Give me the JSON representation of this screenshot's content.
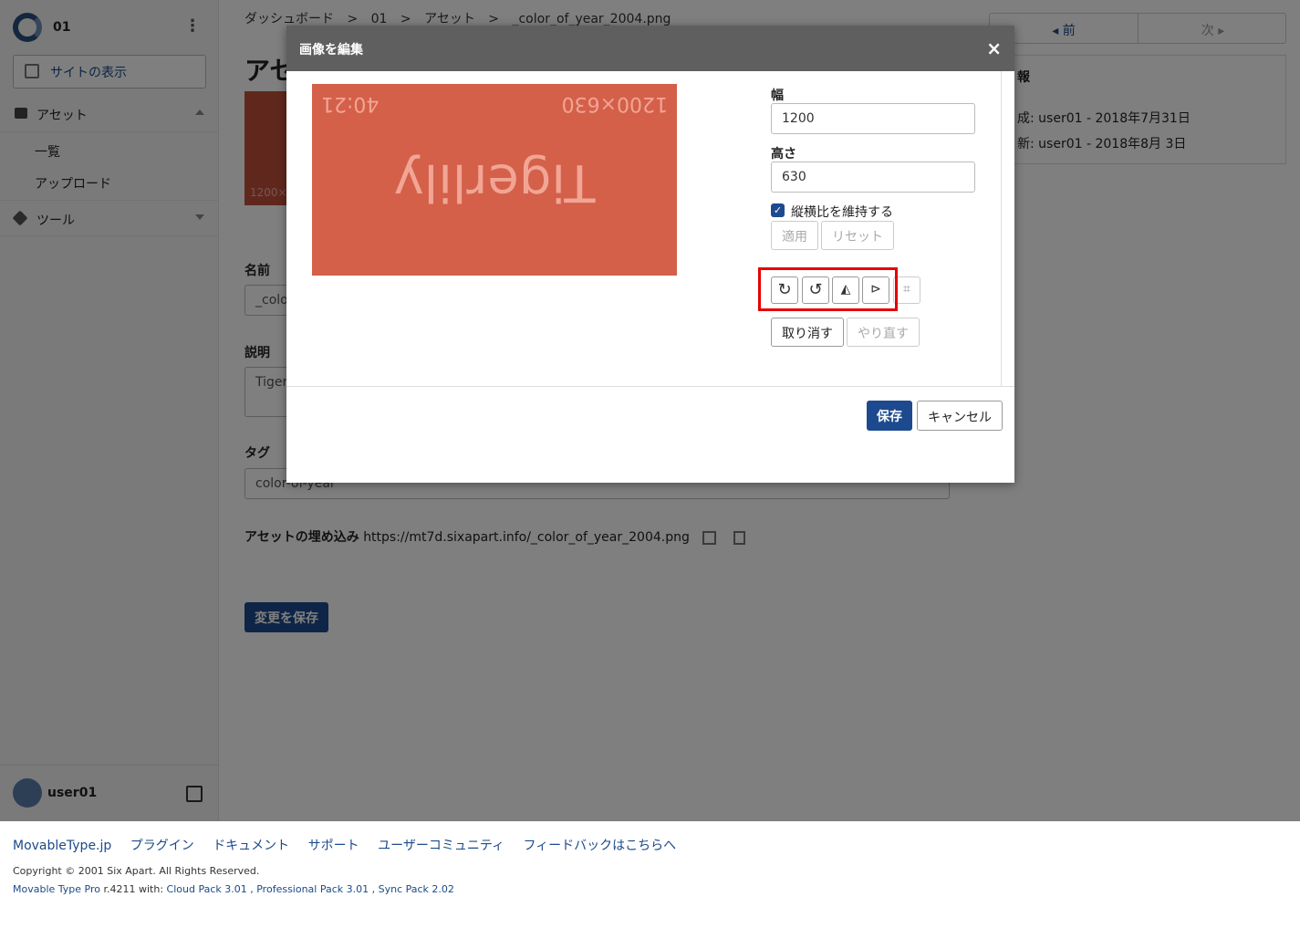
{
  "sidebar": {
    "site_name": "01",
    "view_site": "サイトの表示",
    "sections": [
      {
        "label": "アセット",
        "items": [
          "一覧",
          "アップロード"
        ]
      },
      {
        "label": "ツール"
      }
    ],
    "user": "user01"
  },
  "breadcrumb": [
    "ダッシュボード",
    ">",
    "01",
    ">",
    "アセット",
    ">",
    "_color_of_year_2004.png"
  ],
  "main": {
    "title": "アセ",
    "thumb_text": "1200×",
    "name_label": "名前",
    "name_value": "_colo",
    "desc_label": "説明",
    "desc_value": "Tiger",
    "tag_label": "タグ",
    "tag_value": "color-of-year",
    "embed_label": "アセットの埋め込み",
    "embed_url": "https://mt7d.sixapart.info/_color_of_year_2004.png",
    "save_changes": "変更を保存"
  },
  "right": {
    "prev": "◂ 前",
    "next": "次 ▸",
    "info_title": "報",
    "created": "成: user01 - 2018年7月31日",
    "updated": "新: user01 - 2018年8月 3日"
  },
  "modal": {
    "title": "画像を編集",
    "close": "×",
    "preview": {
      "size": "1200×630",
      "ratio": "40:21",
      "name": "Tigerlily",
      "bg_color": "#d4604a"
    },
    "width_label": "幅",
    "width_value": "1200",
    "height_label": "高さ",
    "height_value": "630",
    "keep_ratio": "縦横比を維持する",
    "keep_ratio_checked": true,
    "apply": "適用",
    "reset": "リセット",
    "tools": [
      "rotate-right-icon",
      "rotate-left-icon",
      "flip-horizontal-icon",
      "flip-vertical-icon",
      "crop-icon"
    ],
    "undo": "取り消す",
    "redo": "やり直す",
    "save": "保存",
    "cancel": "キャンセル"
  },
  "footer": {
    "links": [
      "MovableType.jp",
      "プラグイン",
      "ドキュメント",
      "サポート",
      "ユーザーコミュニティ",
      "フィードバックはこちらへ"
    ],
    "copyright": "Copyright © 2001 Six Apart. All Rights Reserved.",
    "version_product": "Movable Type Pro",
    "version_rest": " r.4211 with: ",
    "packs": "Cloud Pack 3.01 , Professional Pack 3.01 , Sync Pack 2.02"
  },
  "colors": {
    "accent": "#1d4a8f",
    "highlight": "#e50000"
  }
}
